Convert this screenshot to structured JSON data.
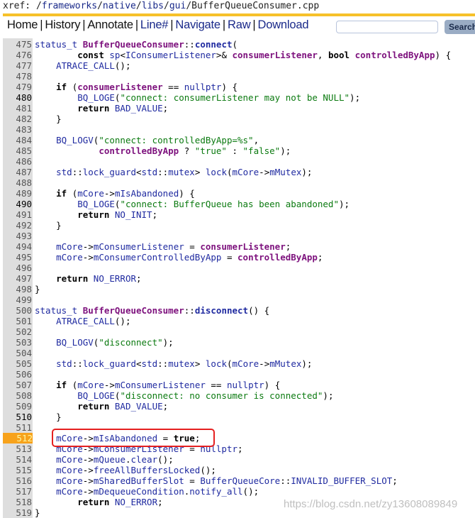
{
  "header": {
    "xref_prefix": "xref: /",
    "path": [
      {
        "label": "frameworks"
      },
      {
        "label": "native"
      },
      {
        "label": "libs"
      },
      {
        "label": "gui"
      }
    ],
    "file": "BufferQueueConsumer.cpp"
  },
  "nav": {
    "items": [
      {
        "label": "Home",
        "style": "blk"
      },
      {
        "label": "History",
        "style": "blk"
      },
      {
        "label": "Annotate",
        "style": "blk"
      },
      {
        "label": "Line#",
        "style": "lnk"
      },
      {
        "label": "Navigate",
        "style": "lnk"
      },
      {
        "label": "Raw",
        "style": "lnk"
      },
      {
        "label": "Download",
        "style": "lnk"
      }
    ],
    "separator": "|",
    "search_value": "",
    "search_button": "Search"
  },
  "colors": {
    "accent": "#f6c12a",
    "highlight_line": "#f7a21b",
    "annotation_box": "#e52020"
  },
  "code": {
    "highlighted_line": 512,
    "bold_lines": [
      480,
      490,
      510
    ],
    "lines": [
      {
        "n": "475",
        "src": "@i{status_t} @d{BufferQueueConsumer}::@f{connect}("
      },
      {
        "n": "476",
        "src": "        @k{const} @i{sp}<@i{IConsumerListener}>& @d{consumerListener}, @k{bool} @d{controlledByApp}) {"
      },
      {
        "n": "477",
        "src": "    @i{ATRACE_CALL}();"
      },
      {
        "n": "478",
        "src": ""
      },
      {
        "n": "479",
        "src": "    @k{if} (@d{consumerListener} == @i{nullptr}) {"
      },
      {
        "n": "480",
        "src": "        @i{BQ_LOGE}(@s{\"connect: consumerListener may not be NULL\"});"
      },
      {
        "n": "481",
        "src": "        @k{return} @i{BAD_VALUE};"
      },
      {
        "n": "482",
        "src": "    }"
      },
      {
        "n": "483",
        "src": ""
      },
      {
        "n": "484",
        "src": "    @i{BQ_LOGV}(@s{\"connect: controlledByApp=%s\"},"
      },
      {
        "n": "485",
        "src": "            @d{controlledByApp} ? @s{\"true\"} : @s{\"false\"});"
      },
      {
        "n": "486",
        "src": ""
      },
      {
        "n": "487",
        "src": "    @i{std}::@i{lock_guard}<@i{std}::@i{mutex}> @i{lock}(@i{mCore}->@i{mMutex});"
      },
      {
        "n": "488",
        "src": ""
      },
      {
        "n": "489",
        "src": "    @k{if} (@i{mCore}->@i{mIsAbandoned}) {"
      },
      {
        "n": "490",
        "src": "        @i{BQ_LOGE}(@s{\"connect: BufferQueue has been abandoned\"});"
      },
      {
        "n": "491",
        "src": "        @k{return} @i{NO_INIT};"
      },
      {
        "n": "492",
        "src": "    }"
      },
      {
        "n": "493",
        "src": ""
      },
      {
        "n": "494",
        "src": "    @i{mCore}->@i{mConsumerListener} = @d{consumerListener};"
      },
      {
        "n": "495",
        "src": "    @i{mCore}->@i{mConsumerControlledByApp} = @d{controlledByApp};"
      },
      {
        "n": "496",
        "src": ""
      },
      {
        "n": "497",
        "src": "    @k{return} @i{NO_ERROR};"
      },
      {
        "n": "498",
        "src": "}"
      },
      {
        "n": "499",
        "src": ""
      },
      {
        "n": "500",
        "src": "@i{status_t} @d{BufferQueueConsumer}::@f{disconnect}() {"
      },
      {
        "n": "501",
        "src": "    @i{ATRACE_CALL}();"
      },
      {
        "n": "502",
        "src": ""
      },
      {
        "n": "503",
        "src": "    @i{BQ_LOGV}(@s{\"disconnect\"});"
      },
      {
        "n": "504",
        "src": ""
      },
      {
        "n": "505",
        "src": "    @i{std}::@i{lock_guard}<@i{std}::@i{mutex}> @i{lock}(@i{mCore}->@i{mMutex});"
      },
      {
        "n": "506",
        "src": ""
      },
      {
        "n": "507",
        "src": "    @k{if} (@i{mCore}->@i{mConsumerListener} == @i{nullptr}) {"
      },
      {
        "n": "508",
        "src": "        @i{BQ_LOGE}(@s{\"disconnect: no consumer is connected\"});"
      },
      {
        "n": "509",
        "src": "        @k{return} @i{BAD_VALUE};"
      },
      {
        "n": "510",
        "src": "    }"
      },
      {
        "n": "511",
        "src": ""
      },
      {
        "n": "512",
        "src": "    @i{mCore}->@i{mIsAbandoned} = @k{true};"
      },
      {
        "n": "513",
        "src": "    @i{mCore}->@i{mConsumerListener} = @i{nullptr};"
      },
      {
        "n": "514",
        "src": "    @i{mCore}->@i{mQueue}.@i{clear}();"
      },
      {
        "n": "515",
        "src": "    @i{mCore}->@i{freeAllBuffersLocked}();"
      },
      {
        "n": "516",
        "src": "    @i{mCore}->@i{mSharedBufferSlot} = @i{BufferQueueCore}::@i{INVALID_BUFFER_SLOT};"
      },
      {
        "n": "517",
        "src": "    @i{mCore}->@i{mDequeueCondition}.@i{notify_all}();"
      },
      {
        "n": "518",
        "src": "        @k{return} @i{NO_ERROR};"
      },
      {
        "n": "519",
        "src": "}"
      }
    ]
  },
  "watermark": "https://blog.csdn.net/zy13608089849"
}
